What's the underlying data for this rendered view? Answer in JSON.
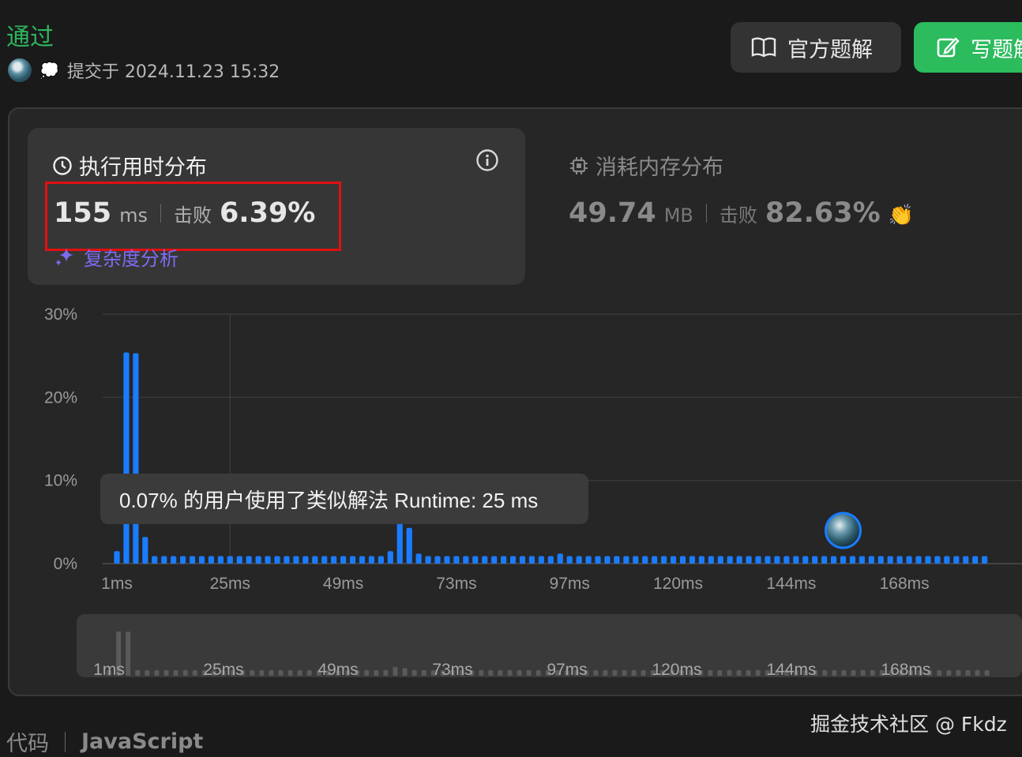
{
  "status": "通过",
  "submission": {
    "text": "提交于 2024.11.23 15:32"
  },
  "buttons": {
    "official_solution": "官方题解",
    "write_solution": "写题解"
  },
  "runtime": {
    "title": "执行用时分布",
    "value": "155",
    "unit": "ms",
    "beat_label": "击败",
    "beat_value": "6.39%",
    "complexity_link": "复杂度分析"
  },
  "memory": {
    "title": "消耗内存分布",
    "value": "49.74",
    "unit": "MB",
    "beat_label": "击败",
    "beat_value": "82.63%"
  },
  "tooltip": "0.07% 的用户使用了类似解法 Runtime: 25 ms",
  "code": {
    "label": "代码",
    "language": "JavaScript"
  },
  "watermark": "掘金技术社区 @ Fkdz",
  "colors": {
    "accent_green": "#2cbb5d",
    "bar_blue": "#1a7cff",
    "highlight_red": "#e01010",
    "link_purple": "#7b6cf0"
  },
  "chart_data": {
    "type": "bar",
    "y_ticks": [
      "0%",
      "10%",
      "20%",
      "30%"
    ],
    "ylim": [
      0,
      30
    ],
    "x_ticks": [
      "1ms",
      "25ms",
      "49ms",
      "73ms",
      "97ms",
      "120ms",
      "144ms",
      "168ms"
    ],
    "user_marker_ms": 155,
    "bars": [
      {
        "x": 1,
        "y": 1.5
      },
      {
        "x": 3,
        "y": 25.4
      },
      {
        "x": 5,
        "y": 25.3
      },
      {
        "x": 7,
        "y": 3.2
      },
      {
        "x": 9,
        "y": 0.9
      },
      {
        "x": 11,
        "y": 0.9
      },
      {
        "x": 13,
        "y": 0.9
      },
      {
        "x": 15,
        "y": 0.9
      },
      {
        "x": 17,
        "y": 0.9
      },
      {
        "x": 19,
        "y": 0.9
      },
      {
        "x": 21,
        "y": 0.9
      },
      {
        "x": 23,
        "y": 0.9
      },
      {
        "x": 25,
        "y": 0.9
      },
      {
        "x": 27,
        "y": 0.9
      },
      {
        "x": 29,
        "y": 0.9
      },
      {
        "x": 31,
        "y": 0.9
      },
      {
        "x": 33,
        "y": 0.9
      },
      {
        "x": 35,
        "y": 0.9
      },
      {
        "x": 37,
        "y": 0.9
      },
      {
        "x": 39,
        "y": 0.9
      },
      {
        "x": 41,
        "y": 0.9
      },
      {
        "x": 43,
        "y": 0.9
      },
      {
        "x": 45,
        "y": 0.9
      },
      {
        "x": 47,
        "y": 0.9
      },
      {
        "x": 49,
        "y": 0.9
      },
      {
        "x": 51,
        "y": 0.9
      },
      {
        "x": 53,
        "y": 0.9
      },
      {
        "x": 55,
        "y": 0.9
      },
      {
        "x": 57,
        "y": 0.9
      },
      {
        "x": 59,
        "y": 1.5
      },
      {
        "x": 61,
        "y": 5.0
      },
      {
        "x": 63,
        "y": 4.3
      },
      {
        "x": 65,
        "y": 1.2
      },
      {
        "x": 67,
        "y": 0.9
      },
      {
        "x": 69,
        "y": 0.9
      },
      {
        "x": 71,
        "y": 0.9
      },
      {
        "x": 73,
        "y": 0.9
      },
      {
        "x": 75,
        "y": 0.9
      },
      {
        "x": 77,
        "y": 0.9
      },
      {
        "x": 79,
        "y": 0.9
      },
      {
        "x": 81,
        "y": 0.9
      },
      {
        "x": 83,
        "y": 0.9
      },
      {
        "x": 85,
        "y": 0.9
      },
      {
        "x": 87,
        "y": 0.9
      },
      {
        "x": 89,
        "y": 0.9
      },
      {
        "x": 91,
        "y": 0.9
      },
      {
        "x": 93,
        "y": 0.9
      },
      {
        "x": 95,
        "y": 1.2
      },
      {
        "x": 97,
        "y": 0.9
      },
      {
        "x": 99,
        "y": 0.9
      },
      {
        "x": 101,
        "y": 0.9
      },
      {
        "x": 103,
        "y": 0.9
      },
      {
        "x": 105,
        "y": 0.9
      },
      {
        "x": 107,
        "y": 0.9
      },
      {
        "x": 109,
        "y": 0.9
      },
      {
        "x": 111,
        "y": 0.9
      },
      {
        "x": 113,
        "y": 0.9
      },
      {
        "x": 115,
        "y": 0.9
      },
      {
        "x": 117,
        "y": 0.9
      },
      {
        "x": 119,
        "y": 0.9
      },
      {
        "x": 121,
        "y": 0.9
      },
      {
        "x": 123,
        "y": 0.9
      },
      {
        "x": 125,
        "y": 0.9
      },
      {
        "x": 127,
        "y": 0.9
      },
      {
        "x": 129,
        "y": 0.9
      },
      {
        "x": 131,
        "y": 0.9
      },
      {
        "x": 133,
        "y": 0.9
      },
      {
        "x": 135,
        "y": 0.9
      },
      {
        "x": 137,
        "y": 0.9
      },
      {
        "x": 139,
        "y": 0.9
      },
      {
        "x": 141,
        "y": 0.9
      },
      {
        "x": 143,
        "y": 0.9
      },
      {
        "x": 145,
        "y": 0.9
      },
      {
        "x": 147,
        "y": 0.9
      },
      {
        "x": 149,
        "y": 0.9
      },
      {
        "x": 151,
        "y": 0.9
      },
      {
        "x": 153,
        "y": 0.9
      },
      {
        "x": 155,
        "y": 0.9
      },
      {
        "x": 157,
        "y": 0.9
      },
      {
        "x": 159,
        "y": 0.9
      },
      {
        "x": 161,
        "y": 0.9
      },
      {
        "x": 163,
        "y": 0.9
      },
      {
        "x": 165,
        "y": 0.9
      },
      {
        "x": 167,
        "y": 0.9
      },
      {
        "x": 169,
        "y": 0.9
      },
      {
        "x": 171,
        "y": 0.9
      },
      {
        "x": 173,
        "y": 0.9
      },
      {
        "x": 175,
        "y": 0.9
      },
      {
        "x": 177,
        "y": 0.9
      },
      {
        "x": 179,
        "y": 0.9
      },
      {
        "x": 181,
        "y": 0.9
      },
      {
        "x": 183,
        "y": 0.9
      },
      {
        "x": 185,
        "y": 0.9
      }
    ]
  }
}
